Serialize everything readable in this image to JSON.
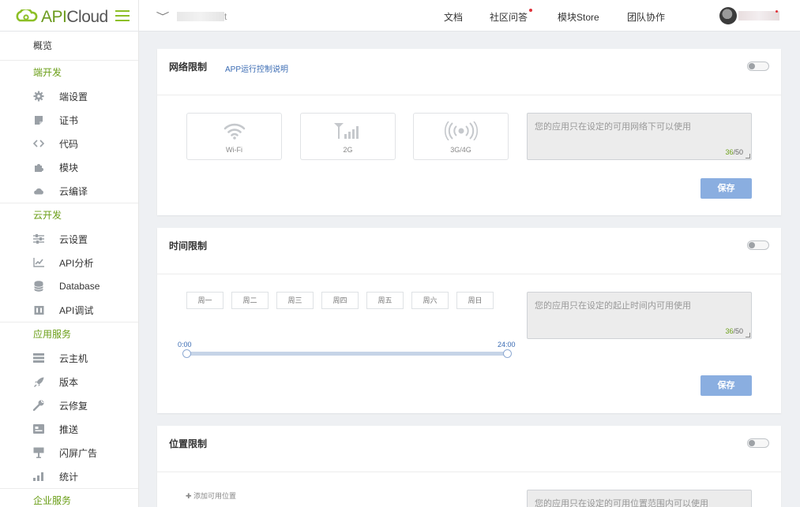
{
  "header": {
    "logo_api": "API",
    "logo_cloud": "Cloud",
    "app_suffix": "t",
    "nav": [
      {
        "label": "文档"
      },
      {
        "label": "社区问答"
      },
      {
        "label": "模块Store"
      },
      {
        "label": "团队协作"
      }
    ]
  },
  "sidebar": {
    "top": "概览",
    "sections": [
      {
        "title": "端开发",
        "items": [
          {
            "label": "端设置",
            "icon": "gear-icon"
          },
          {
            "label": "证书",
            "icon": "certificate-icon"
          },
          {
            "label": "代码",
            "icon": "code-icon"
          },
          {
            "label": "模块",
            "icon": "puzzle-icon"
          },
          {
            "label": "云编译",
            "icon": "cloud-icon"
          }
        ]
      },
      {
        "title": "云开发",
        "items": [
          {
            "label": "云设置",
            "icon": "sliders-icon"
          },
          {
            "label": "API分析",
            "icon": "chart-line-icon"
          },
          {
            "label": "Database",
            "icon": "database-icon"
          },
          {
            "label": "API调试",
            "icon": "debug-icon"
          }
        ]
      },
      {
        "title": "应用服务",
        "items": [
          {
            "label": "云主机",
            "icon": "server-icon"
          },
          {
            "label": "版本",
            "icon": "rocket-icon"
          },
          {
            "label": "云修复",
            "icon": "wrench-icon"
          },
          {
            "label": "推送",
            "icon": "push-icon"
          },
          {
            "label": "闪屏广告",
            "icon": "billboard-icon"
          },
          {
            "label": "统计",
            "icon": "bar-chart-icon"
          }
        ]
      },
      {
        "title": "企业服务",
        "items": []
      }
    ]
  },
  "network": {
    "title": "网络限制",
    "link": "APP运行控制说明",
    "options": [
      {
        "label": "Wi-Fi",
        "icon": "wifi-icon"
      },
      {
        "label": "2G",
        "icon": "signal-icon"
      },
      {
        "label": "3G/4G",
        "icon": "broadcast-icon"
      }
    ],
    "placeholder": "您的应用只在设定的可用网络下可以使用",
    "count_current": "36",
    "count_max": "/50",
    "save": "保存"
  },
  "time": {
    "title": "时间限制",
    "days": [
      "周一",
      "周二",
      "周三",
      "周四",
      "周五",
      "周六",
      "周日"
    ],
    "start": "0:00",
    "end": "24:00",
    "placeholder": "您的应用只在设定的起止时间内可用使用",
    "count_current": "36",
    "count_max": "/50",
    "save": "保存"
  },
  "location": {
    "title": "位置限制",
    "add": "添加可用位置",
    "placeholder": "您的应用只在设定的可用位置范围内可以使用"
  }
}
